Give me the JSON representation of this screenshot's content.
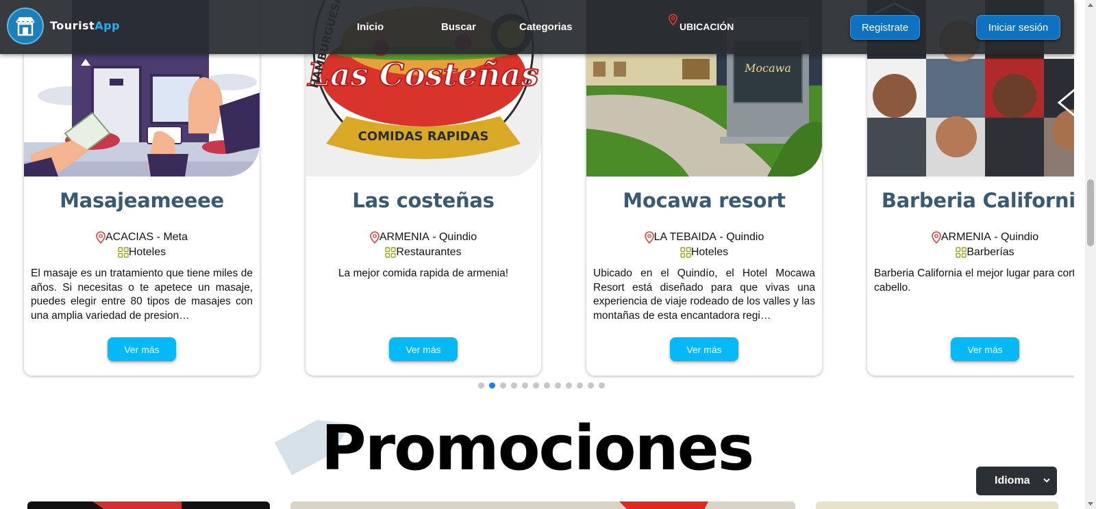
{
  "brand": {
    "part1": "Tourist",
    "part2": "App"
  },
  "nav": {
    "links": [
      {
        "label": "Inicio"
      },
      {
        "label": "Buscar"
      },
      {
        "label": "Categorias"
      },
      {
        "label": "UBICACIÓN"
      }
    ],
    "register": "Registrate",
    "login": "Iniciar sesión"
  },
  "colors": {
    "accent": "#05b8f6",
    "nav_button": "#0d72c1",
    "title": "#3a5a72",
    "location_icon": "#e53935",
    "category_icon": "#9aa21d"
  },
  "cards": [
    {
      "title": "Masajeameeee",
      "city": "ACACIAS",
      "region": "Meta",
      "category": "Hoteles",
      "description": "El masaje es un tratamiento que tiene miles de años. Si necesitas o te apetece un masaje, puedes elegir entre 80 tipos de masajes con una amplia variedad de presion…",
      "button": "Ver más"
    },
    {
      "title": "Las costeñas",
      "city": "ARMENIA",
      "region": "Quindio",
      "category": "Restaurantes",
      "description": "La mejor comida rapida de armenia!",
      "button": "Ver más",
      "image_text_1": "Las Costeñas",
      "image_text_2": "COMIDAS RAPIDAS"
    },
    {
      "title": "Mocawa resort",
      "city": "LA TEBAIDA",
      "region": "Quindio",
      "category": "Hoteles",
      "description": "Ubicado en el Quindío, el Hotel Mocawa Resort está diseñado para que vivas una experiencia de viaje rodeado de los valles y las montañas de esta encantadora regi…",
      "button": "Ver más"
    },
    {
      "title": "Barberia California",
      "city": "ARMENIA",
      "region": "Quindio",
      "category": "Barberías",
      "description": "Barberia California el mejor lugar para corte de cabello.",
      "button": "Ver más"
    }
  ],
  "carousel": {
    "dot_count": 12,
    "active_index": 1
  },
  "promotions": {
    "title": "Promociones"
  },
  "language": {
    "label": "Idioma"
  }
}
